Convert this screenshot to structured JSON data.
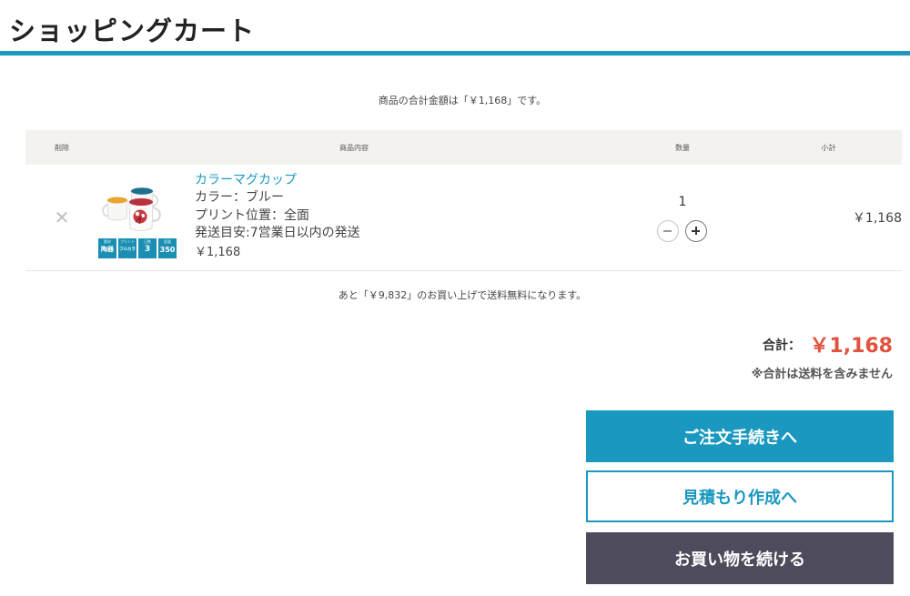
{
  "page": {
    "title": "ショッピングカート"
  },
  "summary": {
    "text": "商品の合計金額は「￥1,168」です。"
  },
  "table": {
    "headers": {
      "remove": "削除",
      "item": "商品内容",
      "qty": "数量",
      "subtotal": "小計"
    }
  },
  "cart": {
    "items": [
      {
        "name": "カラーマグカップ",
        "color": "カラー：ブルー",
        "print_position": "プリント位置：全面",
        "shipping": "発送目安:7営業日以内の発送",
        "price": "￥1,168",
        "quantity": "1",
        "subtotal": "￥1,168",
        "thumb_badges": [
          {
            "top": "素材",
            "main": "陶器"
          },
          {
            "top": "プリント",
            "main": "フルカラー"
          },
          {
            "top": "日数",
            "main": "3"
          },
          {
            "top": "容量",
            "main": "350"
          }
        ]
      }
    ]
  },
  "shipping_note": {
    "text": "あと「￥9,832」のお買い上げで送料無料になります。"
  },
  "totals": {
    "label": "合計：",
    "value": "￥1,168",
    "note": "※合計は送料を含みません"
  },
  "buttons": {
    "checkout": "ご注文手続きへ",
    "quote": "見積もり作成へ",
    "continue": "お買い物を続ける"
  },
  "colors": {
    "accent": "#1a98bf",
    "price": "#e0533f",
    "dark_button": "#4e4c5c",
    "header_bg": "#f3f2ef"
  },
  "icons": {
    "remove": "close-icon",
    "decrease": "minus-circle-icon",
    "increase": "plus-circle-icon"
  }
}
